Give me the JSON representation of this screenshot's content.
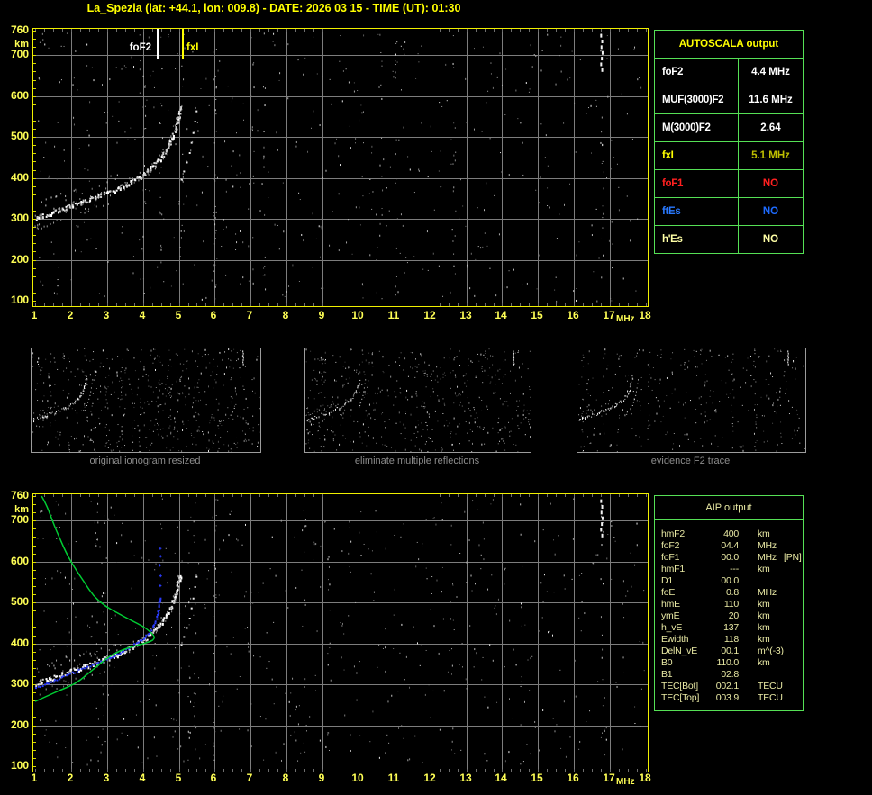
{
  "title": "La_Spezia (lat: +44.1, lon: 009.8) - DATE: 2026 03 15 - TIME (UT): 01:30",
  "colors": {
    "background": "#000000",
    "title": "#FFFF00",
    "axis_label": "#FFFF55",
    "plot_border": "#F0F000",
    "grid": "#7D7D7D",
    "minor_tick": "#6E6E6E",
    "y_tick": "#D8D800",
    "table_border": "#55E055",
    "aip_text": "#E9E9A4",
    "panel_border": "#9C9C9C",
    "panel_caption": "#8C8C8C",
    "profile_green": "#00CC33",
    "restored_blue": "#2B3CFF"
  },
  "axes": {
    "x_ticks": [
      1,
      2,
      3,
      4,
      5,
      6,
      7,
      8,
      9,
      10,
      11,
      12,
      13,
      14,
      15,
      16,
      17,
      18
    ],
    "x_unit": "MHz",
    "y_ticks": [
      760,
      700,
      600,
      500,
      400,
      300,
      200,
      100
    ],
    "y_unit": "km",
    "x_range": [
      1,
      18
    ],
    "y_range": [
      100,
      760
    ]
  },
  "top_chart": {
    "markers": [
      {
        "label": "foF2",
        "freq_mhz": 4.4,
        "color": "#FFFFFF"
      },
      {
        "label": "fxI",
        "freq_mhz": 5.1,
        "color": "#FFFF00"
      }
    ]
  },
  "autoscala": {
    "title": "AUTOSCALA output",
    "rows": [
      {
        "param": "foF2",
        "value": "4.4 MHz",
        "param_color": "#FFFFFF",
        "value_color": "#FFFFFF"
      },
      {
        "param": "MUF(3000)F2",
        "value": "11.6 MHz",
        "param_color": "#FFFFFF",
        "value_color": "#FFFFFF"
      },
      {
        "param": "M(3000)F2",
        "value": "2.64",
        "param_color": "#FFFFFF",
        "value_color": "#FFFFFF"
      },
      {
        "param": "fxI",
        "value": "5.1 MHz",
        "param_color": "#FFFF00",
        "value_color": "#BEBE00"
      },
      {
        "param": "foF1",
        "value": "NO",
        "param_color": "#FF2020",
        "value_color": "#FF2020"
      },
      {
        "param": "ftEs",
        "value": "NO",
        "param_color": "#2979FF",
        "value_color": "#1E6BFF"
      },
      {
        "param": "h'Es",
        "value": "NO",
        "param_color": "#FFFFA6",
        "value_color": "#FFFFA6"
      }
    ]
  },
  "panels": [
    {
      "caption": "original ionogram resized"
    },
    {
      "caption": "eliminate multiple reflections"
    },
    {
      "caption": "evidence F2 trace"
    }
  ],
  "aip": {
    "title": "AIP output",
    "rows": [
      {
        "param": "hmF2",
        "value": "400",
        "unit": "km",
        "note": ""
      },
      {
        "param": "foF2",
        "value": "04.4",
        "unit": "MHz",
        "note": ""
      },
      {
        "param": "foF1",
        "value": "00.0",
        "unit": "MHz",
        "note": "[PN]"
      },
      {
        "param": "hmF1",
        "value": "---",
        "unit": "km",
        "note": ""
      },
      {
        "param": "D1",
        "value": "00.0",
        "unit": "",
        "note": ""
      },
      {
        "param": "foE",
        "value": "0.8",
        "unit": "MHz",
        "note": ""
      },
      {
        "param": "hmE",
        "value": "110",
        "unit": "km",
        "note": ""
      },
      {
        "param": "ymE",
        "value": "20",
        "unit": "km",
        "note": ""
      },
      {
        "param": "h_vE",
        "value": "137",
        "unit": "km",
        "note": ""
      },
      {
        "param": "Ewidth",
        "value": "118",
        "unit": "km",
        "note": ""
      },
      {
        "param": "DelN_vE",
        "value": "00.1",
        "unit": "m^(-3)",
        "note": ""
      },
      {
        "param": "B0",
        "value": "110.0",
        "unit": "km",
        "note": ""
      },
      {
        "param": "B1",
        "value": "02.8",
        "unit": "",
        "note": ""
      },
      {
        "param": "TEC[Bot]",
        "value": "002.1",
        "unit": "TECU",
        "note": ""
      },
      {
        "param": "TEC[Top]",
        "value": "003.9",
        "unit": "TECU",
        "note": ""
      }
    ]
  },
  "chart_data": [
    {
      "type": "scatter",
      "title": "scaled ionogram with AUTOSCALA markers (top plot)",
      "xlabel": "MHz",
      "ylabel": "km",
      "xlim": [
        1,
        18
      ],
      "ylim": [
        100,
        760
      ],
      "grid": true,
      "series": [
        {
          "name": "F2-layer o-mode trace",
          "role": "trace-fuzzy",
          "color": "#FFFFFF",
          "points": [
            [
              1.0,
              303
            ],
            [
              1.3,
              313
            ],
            [
              1.6,
              322
            ],
            [
              1.9,
              331
            ],
            [
              2.2,
              340
            ],
            [
              2.5,
              349
            ],
            [
              2.8,
              358
            ],
            [
              3.1,
              368
            ],
            [
              3.4,
              380
            ],
            [
              3.7,
              394
            ],
            [
              4.0,
              410
            ],
            [
              4.2,
              424
            ],
            [
              4.4,
              441
            ],
            [
              4.55,
              458
            ],
            [
              4.7,
              478
            ],
            [
              4.8,
              497
            ],
            [
              4.88,
              517
            ],
            [
              4.94,
              537
            ],
            [
              5.0,
              558
            ],
            [
              5.04,
              575
            ]
          ]
        },
        {
          "name": "x-mode echoes",
          "role": "dots-sparse",
          "color": "#E9E9E9",
          "points": [
            [
              5.05,
              398
            ],
            [
              5.12,
              418
            ],
            [
              5.2,
              440
            ],
            [
              5.28,
              463
            ],
            [
              5.33,
              488
            ],
            [
              5.38,
              512
            ],
            [
              5.43,
              540
            ],
            [
              5.47,
              565
            ]
          ]
        },
        {
          "name": "interference streak",
          "role": "streak",
          "color": "#F4F4F4",
          "points": [
            [
              16.73,
              752
            ],
            [
              16.76,
              738
            ],
            [
              16.74,
              724
            ],
            [
              16.77,
              710
            ],
            [
              16.75,
              696
            ],
            [
              16.73,
              682
            ],
            [
              16.76,
              668
            ]
          ]
        }
      ],
      "annotations": [
        {
          "label": "foF2",
          "x": 4.4,
          "color": "#FFFFFF"
        },
        {
          "label": "fxI",
          "x": 5.1,
          "color": "#FFFF00"
        }
      ]
    },
    {
      "type": "scatter",
      "title": "ionogram with restored trace and electron density profile (bottom plot)",
      "xlabel": "MHz",
      "ylabel": "km",
      "xlim": [
        1,
        18
      ],
      "ylim": [
        100,
        760
      ],
      "grid": true,
      "series": [
        {
          "name": "F2-layer o-mode trace",
          "role": "trace-fuzzy",
          "color": "#FFFFFF",
          "points": [
            [
              1.0,
              303
            ],
            [
              1.3,
              313
            ],
            [
              1.6,
              322
            ],
            [
              1.9,
              331
            ],
            [
              2.2,
              340
            ],
            [
              2.5,
              349
            ],
            [
              2.8,
              358
            ],
            [
              3.1,
              368
            ],
            [
              3.4,
              380
            ],
            [
              3.7,
              394
            ],
            [
              4.0,
              410
            ],
            [
              4.2,
              424
            ],
            [
              4.4,
              441
            ],
            [
              4.55,
              458
            ],
            [
              4.7,
              478
            ],
            [
              4.8,
              497
            ],
            [
              4.88,
              517
            ],
            [
              4.94,
              537
            ],
            [
              5.0,
              558
            ],
            [
              5.04,
              575
            ]
          ]
        },
        {
          "name": "x-mode echoes",
          "role": "dots-sparse",
          "color": "#E9E9E9",
          "points": [
            [
              5.05,
              398
            ],
            [
              5.12,
              418
            ],
            [
              5.2,
              440
            ],
            [
              5.28,
              463
            ],
            [
              5.33,
              488
            ],
            [
              5.38,
              512
            ],
            [
              5.43,
              540
            ],
            [
              5.47,
              565
            ]
          ]
        },
        {
          "name": "interference streak",
          "role": "streak",
          "color": "#F4F4F4",
          "points": [
            [
              16.73,
              752
            ],
            [
              16.76,
              738
            ],
            [
              16.74,
              724
            ],
            [
              16.77,
              710
            ],
            [
              16.75,
              696
            ],
            [
              16.73,
              682
            ],
            [
              16.76,
              668
            ]
          ]
        },
        {
          "name": "restored trace",
          "role": "trace-blue",
          "color": "#2B3CFF",
          "points": [
            [
              1.0,
              292
            ],
            [
              1.3,
              303
            ],
            [
              1.6,
              314
            ],
            [
              1.9,
              325
            ],
            [
              2.2,
              336
            ],
            [
              2.5,
              347
            ],
            [
              2.8,
              357
            ],
            [
              3.1,
              368
            ],
            [
              3.4,
              381
            ],
            [
              3.7,
              396
            ],
            [
              3.95,
              411
            ],
            [
              4.15,
              427
            ],
            [
              4.28,
              443
            ],
            [
              4.36,
              461
            ],
            [
              4.41,
              480
            ],
            [
              4.44,
              500
            ],
            [
              4.46,
              518
            ]
          ]
        },
        {
          "name": "restored trace tail",
          "role": "dots-blue",
          "color": "#2B3CFF",
          "points": [
            [
              4.47,
              542
            ],
            [
              4.48,
              566
            ],
            [
              4.46,
              592
            ],
            [
              4.48,
              614
            ],
            [
              4.47,
              633
            ]
          ]
        },
        {
          "name": "electron density profile",
          "role": "line-green",
          "color": "#00CC33",
          "points": [
            [
              1.0,
              258
            ],
            [
              1.35,
              272
            ],
            [
              1.7,
              286
            ],
            [
              2.1,
              300
            ],
            [
              2.45,
              324
            ],
            [
              2.8,
              350
            ],
            [
              3.15,
              374
            ],
            [
              3.55,
              388
            ],
            [
              3.95,
              398
            ],
            [
              4.22,
              405
            ],
            [
              4.33,
              412
            ],
            [
              4.3,
              420
            ],
            [
              4.18,
              430
            ],
            [
              4.0,
              442
            ],
            [
              3.68,
              456
            ],
            [
              3.3,
              474
            ],
            [
              2.95,
              491
            ],
            [
              2.62,
              516
            ],
            [
              2.38,
              548
            ],
            [
              2.18,
              574
            ],
            [
              2.0,
              600
            ],
            [
              1.85,
              624
            ],
            [
              1.72,
              650
            ],
            [
              1.6,
              674
            ],
            [
              1.48,
              700
            ],
            [
              1.38,
              724
            ],
            [
              1.28,
              744
            ],
            [
              1.18,
              760
            ]
          ]
        }
      ]
    }
  ]
}
